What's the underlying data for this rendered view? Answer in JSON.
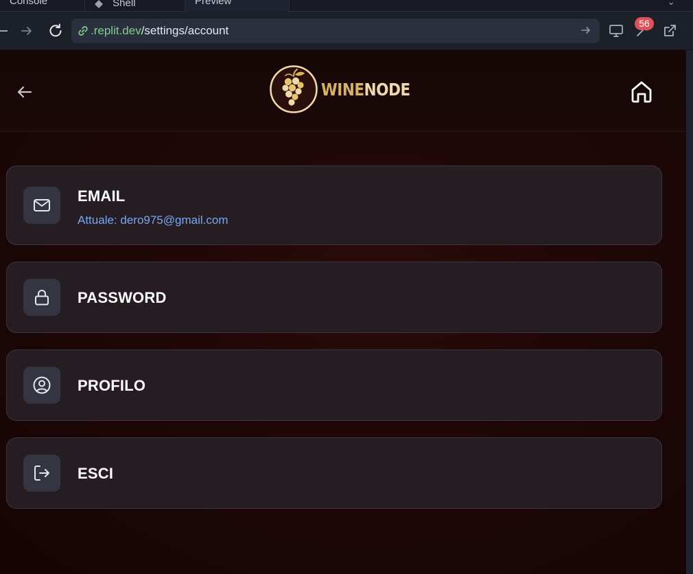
{
  "browser": {
    "tabs": [
      {
        "label": "Console"
      },
      {
        "label": "Shell"
      },
      {
        "label": "Preview"
      }
    ],
    "url_host": ".replit.dev",
    "url_path": "/settings/account",
    "notification_count": "56"
  },
  "app": {
    "brand_wine": "WINE",
    "brand_node": "NODE",
    "accent_color": "#d9b25e",
    "settings": [
      {
        "title": "EMAIL",
        "subtitle": "Attuale: dero975@gmail.com",
        "icon": "mail-icon"
      },
      {
        "title": "PASSWORD",
        "icon": "lock-icon"
      },
      {
        "title": "PROFILO",
        "icon": "user-circle-icon"
      },
      {
        "title": "ESCI",
        "icon": "logout-icon"
      }
    ]
  }
}
